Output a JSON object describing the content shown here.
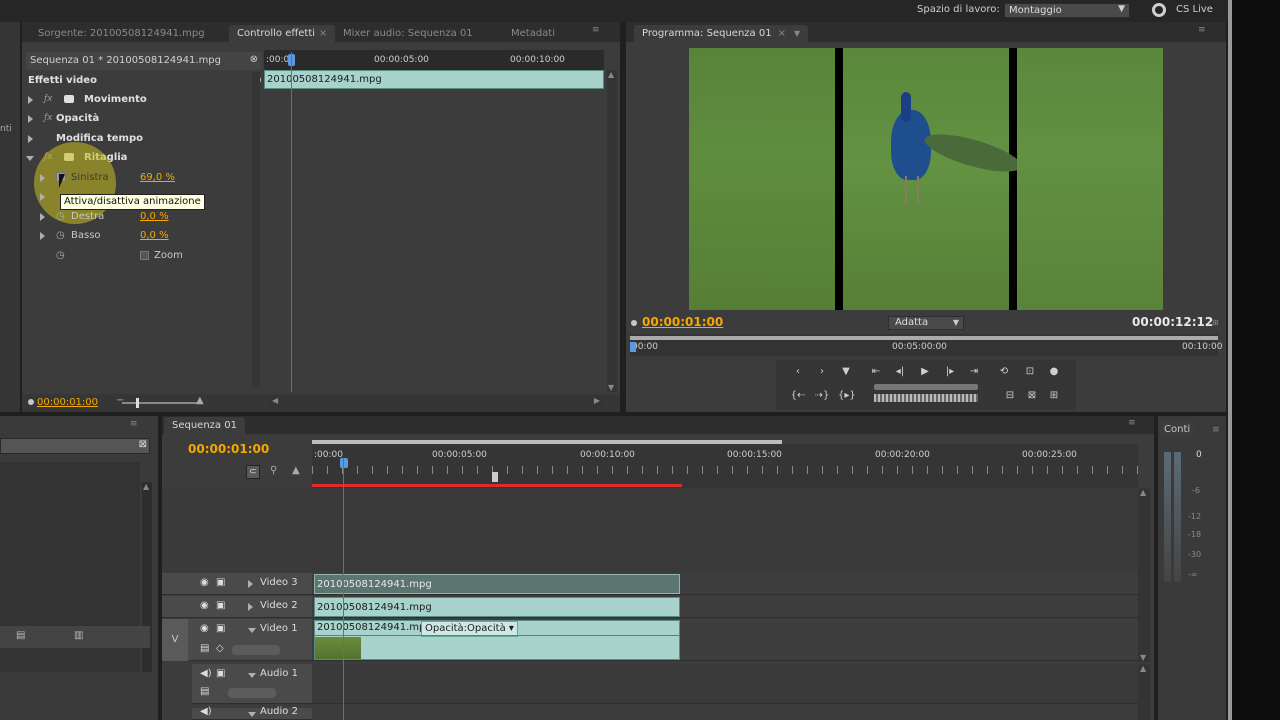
{
  "topbar": {
    "workspace_label": "Spazio di lavoro:",
    "workspace_value": "Montaggio",
    "cslive_label": "CS Live"
  },
  "effects_panel": {
    "tabs": [
      {
        "label": "Sorgente: 20100508124941.mpg"
      },
      {
        "label": "Controllo effetti"
      },
      {
        "label": "Mixer audio: Sequenza 01"
      },
      {
        "label": "Metadati"
      }
    ],
    "sequence_label": "Sequenza 01 * 20100508124941.mpg",
    "ruler_start": ":00:00",
    "ruler_mid": "00:00:05:00",
    "ruler_end": "00:00:10:00",
    "clip_name": "20100508124941.mpg",
    "section_title": "Effetti video",
    "effects": [
      {
        "name": "Movimento"
      },
      {
        "name": "Opacità"
      },
      {
        "name": "Modifica tempo"
      },
      {
        "name": "Ritaglia"
      }
    ],
    "params": [
      {
        "name": "Sinistra",
        "value": "69,0 %"
      },
      {
        "name": "Destra",
        "value": "0,0 %"
      },
      {
        "name": "Basso",
        "value": "0,0 %"
      }
    ],
    "tooltip": "Attiva/disattiva animazione",
    "zoom_label": "Zoom",
    "timecode": "00:00:01:00"
  },
  "program_monitor": {
    "tab": "Programma: Sequenza 01",
    "timecode_current": "00:00:01:00",
    "fit_label": "Adatta",
    "timecode_duration": "00:00:12:12",
    "ruler_start": "00:00",
    "ruler_mid": "00:05:00:00",
    "ruler_end": "00:10:00"
  },
  "timeline": {
    "tab": "Sequenza 01",
    "timecode": "00:00:01:00",
    "ruler_labels": [
      ":00:00",
      "00:00:05:00",
      "00:00:10:00",
      "00:00:15:00",
      "00:00:20:00",
      "00:00:25:00"
    ],
    "tracks": [
      {
        "name": "Video 3",
        "clip": "20100508124941.mpg"
      },
      {
        "name": "Video 2",
        "clip": "20100508124941.mpg"
      },
      {
        "name": "Video 1",
        "clip": "20100508124941.mpg",
        "extra": "Opacità:Opacità"
      },
      {
        "name": "Audio 1"
      },
      {
        "name": "Audio 2"
      }
    ],
    "v_label": "V"
  },
  "audio_meter": {
    "tab": "Conti",
    "scale": [
      "0",
      "-6",
      "-12",
      "-18",
      "-30",
      "-∞"
    ]
  }
}
